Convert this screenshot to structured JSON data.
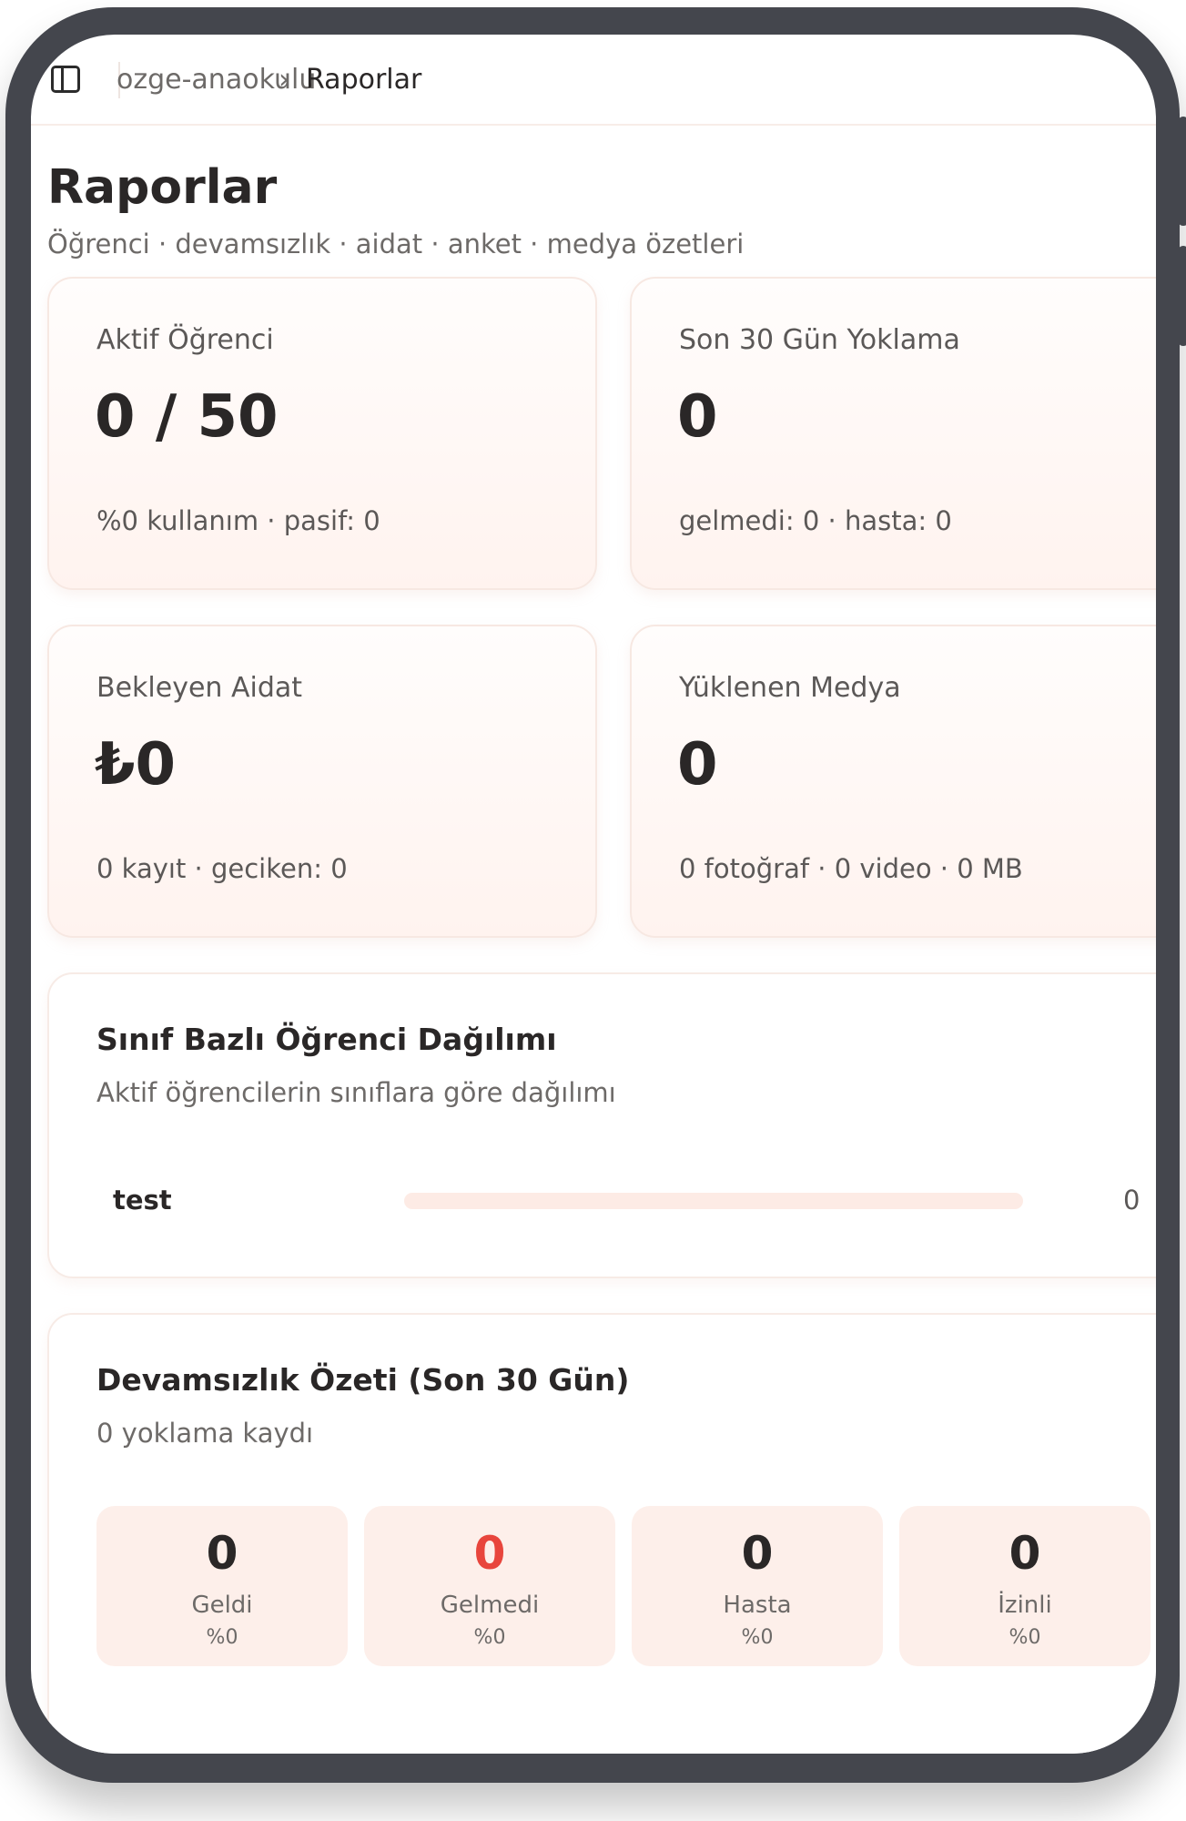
{
  "header": {
    "breadcrumb": [
      "ozge-anaokulu",
      "Raporlar"
    ],
    "separator": "›"
  },
  "page": {
    "title": "Raporlar",
    "subtitle": "Öğrenci · devamsızlık · aidat · anket · medya özetleri"
  },
  "cards": {
    "students": {
      "label": "Aktif Öğrenci",
      "value": "0 / 50",
      "foot": "%0 kullanım · pasif: 0"
    },
    "attendance": {
      "label": "Son 30 Gün Yoklama",
      "value": "0",
      "foot": "gelmedi: 0 · hasta: 0"
    },
    "fees": {
      "label": "Bekleyen Aidat",
      "value": "₺0",
      "foot": "0 kayıt · geciken: 0"
    },
    "media": {
      "label": "Yüklenen Medya",
      "value": "0",
      "foot": "0 fotoğraf · 0 video · 0 MB"
    }
  },
  "class_distribution": {
    "title": "Sınıf Bazlı Öğrenci Dağılımı",
    "subtitle": "Aktif öğrencilerin sınıflara göre dağılımı",
    "rows": [
      {
        "name": "test",
        "count": "0",
        "fraction": 0
      }
    ]
  },
  "absence_summary": {
    "title": "Devamsızlık Özeti (Son 30 Gün)",
    "subtitle": "0 yoklama kaydı",
    "stats": [
      {
        "value": "0",
        "label": "Geldi",
        "percent": "%0"
      },
      {
        "value": "0",
        "label": "Gelmedi",
        "percent": "%0"
      },
      {
        "value": "0",
        "label": "Hasta",
        "percent": "%0"
      },
      {
        "value": "0",
        "label": "İzinli",
        "percent": "%0"
      }
    ]
  },
  "colors": {
    "accent": "#e8453c",
    "card_bg": "#fff3ef",
    "bar_track": "#fdebe5",
    "frame": "#44464d"
  },
  "icons": {
    "sidebar_toggle": "sidebar-toggle-icon"
  }
}
